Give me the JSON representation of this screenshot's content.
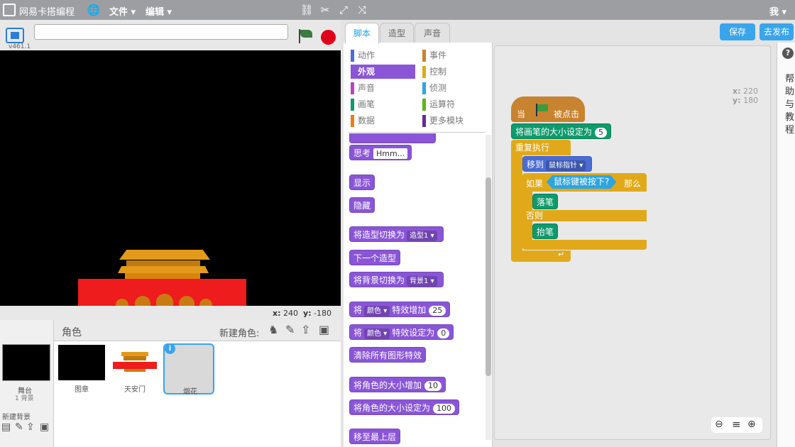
{
  "menubar": {
    "logo_text": "网易卡搭编程",
    "file_menu": "文件",
    "edit_menu": "编辑",
    "user_menu": "我"
  },
  "stage": {
    "version": "v461.1",
    "title_value": "",
    "coord_x_label": "x:",
    "coord_x": "240",
    "coord_y_label": "y:",
    "coord_y": "-180"
  },
  "sprites": {
    "header": "角色",
    "new_sprite_label": "新建角色:",
    "stage_label": "舞台",
    "stage_backdrops": "1 背景",
    "new_backdrop_label": "新建背景",
    "items": [
      {
        "name": "图章"
      },
      {
        "name": "天安门"
      },
      {
        "name": "烟花"
      }
    ]
  },
  "tabs": [
    "脚本",
    "造型",
    "声音"
  ],
  "categories": [
    {
      "label": "动作",
      "color": "#4a6cd4"
    },
    {
      "label": "事件",
      "color": "#c88330"
    },
    {
      "label": "外观",
      "color": "#8a55d7"
    },
    {
      "label": "控制",
      "color": "#e1a91a"
    },
    {
      "label": "声音",
      "color": "#bb42c3"
    },
    {
      "label": "侦测",
      "color": "#2ca5e2"
    },
    {
      "label": "画笔",
      "color": "#0e9a6c"
    },
    {
      "label": "运算符",
      "color": "#5cb712"
    },
    {
      "label": "数据",
      "color": "#ee7d16"
    },
    {
      "label": "更多模块",
      "color": "#632d99"
    }
  ],
  "palette": {
    "think": "思考",
    "think_default": "Hmm...",
    "show": "显示",
    "hide": "隐藏",
    "switch_costume": "将造型切换为",
    "costume_value": "造型1",
    "next_costume": "下一个造型",
    "switch_backdrop": "将背景切换为",
    "backdrop_value": "背景1",
    "effect_prefix": "将",
    "effect_value": "颜色",
    "change_effect": "特效增加",
    "change_effect_amount": "25",
    "set_effect": "特效设定为",
    "set_effect_amount": "0",
    "clear_effects": "清除所有图形特效",
    "change_size": "将角色的大小增加",
    "change_size_amount": "10",
    "set_size": "将角色的大小设定为",
    "set_size_amount": "100",
    "go_front": "移至最上层"
  },
  "script": {
    "when_prefix": "当",
    "when_suffix": "被点击",
    "set_pen_size": "将画笔的大小设定为",
    "pen_size": "5",
    "forever": "重复执行",
    "goto": "移到",
    "goto_target": "鼠标指针",
    "if_label": "如果",
    "condition": "鼠标键被按下?",
    "then_label": "那么",
    "pen_down": "落笔",
    "else_label": "否则",
    "pen_up": "抬笔"
  },
  "script_area": {
    "x_label": "x:",
    "x": "220",
    "y_label": "y:",
    "y": "180"
  },
  "buttons": {
    "save": "保存",
    "publish": "去发布"
  },
  "help": {
    "icon": "?",
    "label": [
      "帮",
      "助",
      "与",
      "教",
      "程"
    ]
  },
  "colors": {
    "accent": "#3aa4ec",
    "stop": "#e0001b"
  }
}
